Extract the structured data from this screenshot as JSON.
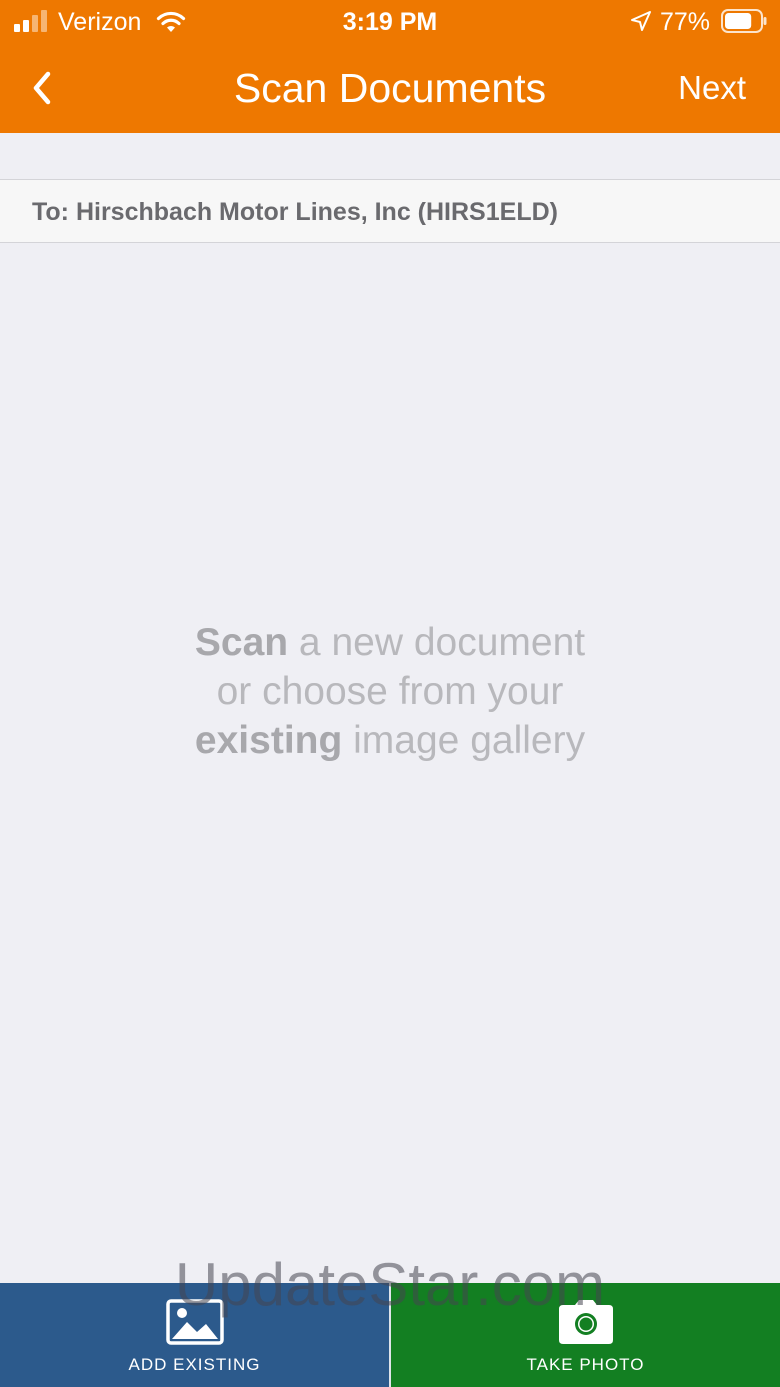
{
  "status_bar": {
    "carrier": "Verizon",
    "time": "3:19 PM",
    "battery_percent": "77%",
    "battery_level": 0.77,
    "icons": [
      "signal-icon",
      "wifi-icon",
      "location-arrow-icon",
      "battery-icon"
    ]
  },
  "nav": {
    "back_icon": "chevron-left-icon",
    "title": "Scan Documents",
    "next_label": "Next"
  },
  "recipient": {
    "text": "To: Hirschbach Motor Lines, Inc (HIRS1ELD)"
  },
  "empty_state": {
    "line1_bold": "Scan",
    "line1_rest": " a new document",
    "line2": "or choose from your",
    "line3_bold": "existing",
    "line3_rest": " image gallery"
  },
  "watermark": "UpdateStar.com",
  "actions": {
    "add_existing": {
      "label": "ADD EXISTING",
      "icon": "image-gallery-icon",
      "color": "#2c5a8c"
    },
    "take_photo": {
      "label": "TAKE PHOTO",
      "icon": "camera-icon",
      "color": "#137f22"
    }
  },
  "colors": {
    "header": "#ee7800",
    "background": "#efeff4"
  }
}
